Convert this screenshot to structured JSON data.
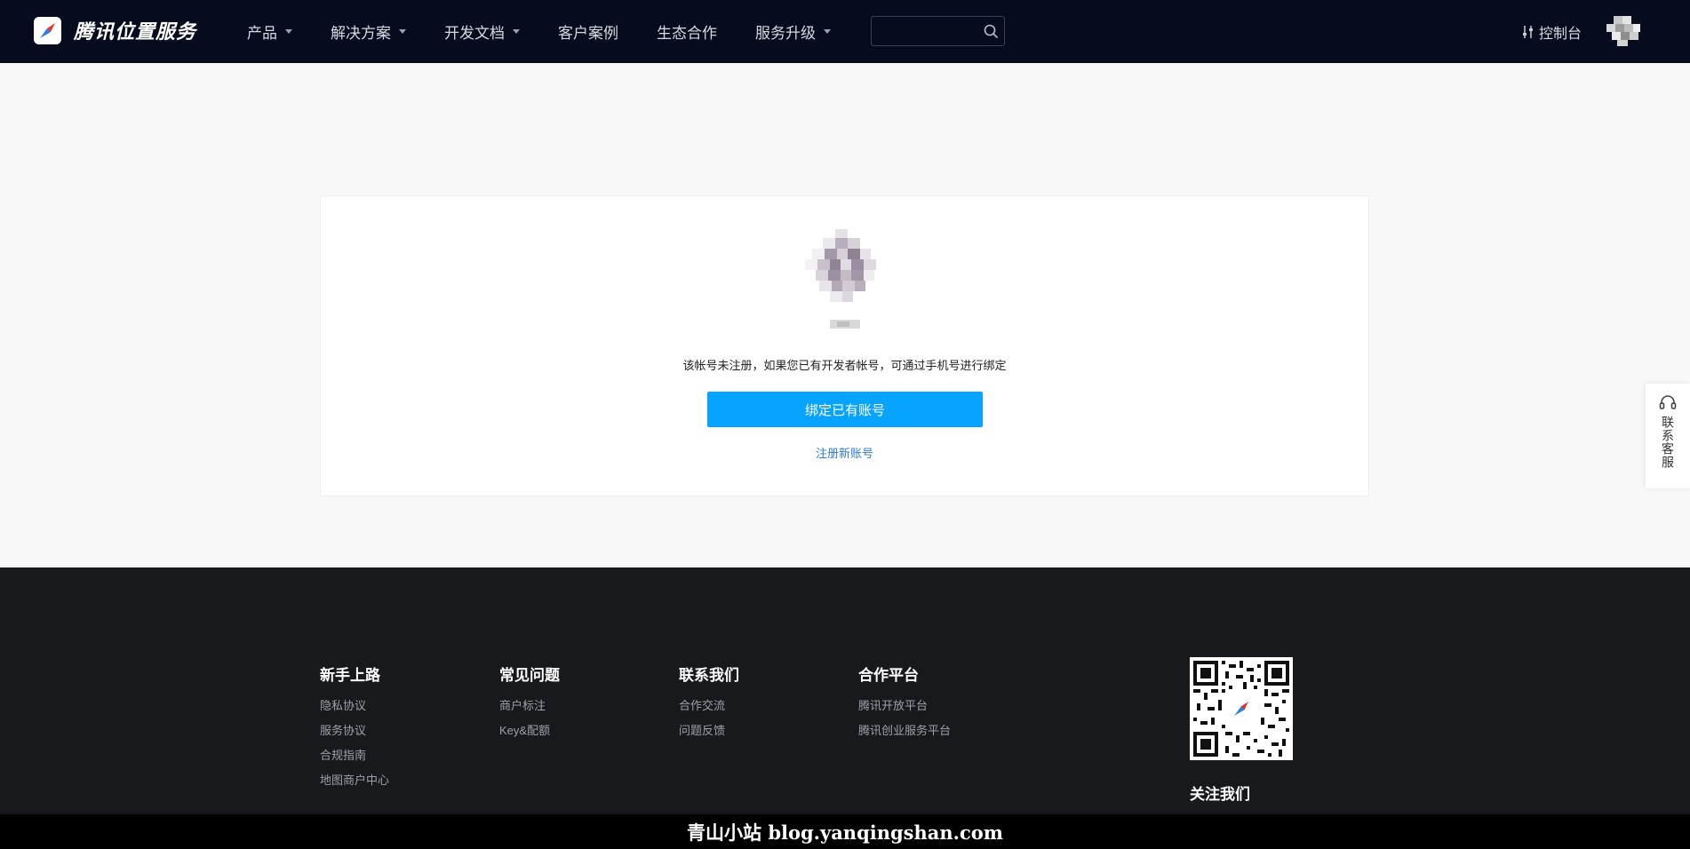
{
  "header": {
    "brand": "腾讯位置服务",
    "nav": [
      {
        "label": "产品",
        "dropdown": true
      },
      {
        "label": "解决方案",
        "dropdown": true
      },
      {
        "label": "开发文档",
        "dropdown": true
      },
      {
        "label": "客户案例",
        "dropdown": false
      },
      {
        "label": "生态合作",
        "dropdown": false
      },
      {
        "label": "服务升级",
        "dropdown": true
      }
    ],
    "search": {
      "value": "",
      "placeholder": ""
    },
    "console_label": "控制台"
  },
  "card": {
    "message": "该帐号未注册，如果您已有开发者帐号，可通过手机号进行绑定",
    "bind_button": "绑定已有账号",
    "register_link": "注册新账号"
  },
  "side": {
    "service_label": "联系客服"
  },
  "footer": {
    "columns": [
      {
        "title": "新手上路",
        "links": [
          "隐私协议",
          "服务协议",
          "合规指南",
          "地图商户中心"
        ]
      },
      {
        "title": "常见问题",
        "links": [
          "商户标注",
          "Key&配额"
        ]
      },
      {
        "title": "联系我们",
        "links": [
          "合作交流",
          "问题反馈"
        ]
      },
      {
        "title": "合作平台",
        "links": [
          "腾讯开放平台",
          "腾讯创业服务平台"
        ]
      }
    ],
    "follow_label": "关注我们"
  },
  "watermark": "青山小站 blog.yanqingshan.com",
  "colors": {
    "header_bg": "#060c1e",
    "primary_button": "#06a3ff",
    "link": "#2f7bd8",
    "footer_bg": "#18191d"
  },
  "icons": {
    "brand": "compass-logo-icon",
    "search": "search-icon",
    "console": "sliders-icon",
    "service": "headset-icon"
  }
}
